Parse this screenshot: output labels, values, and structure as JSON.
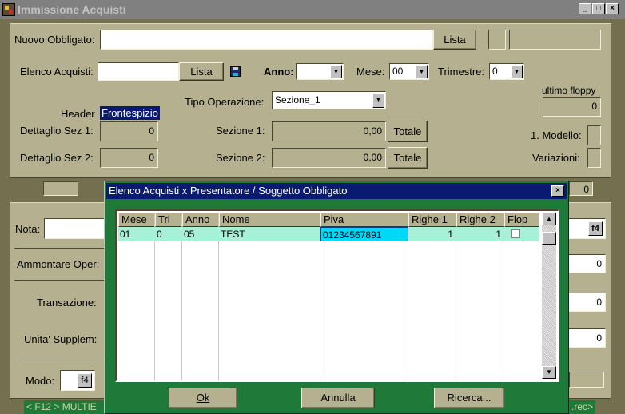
{
  "window": {
    "title": "Immissione  Acquisti"
  },
  "top": {
    "nuovo_obbligato_label": "Nuovo Obbligato:",
    "nuovo_obbligato_value": "",
    "lista1": "Lista",
    "elenco_acquisti_label": "Elenco Acquisti:",
    "lista2": "Lista",
    "anno_label": "Anno:",
    "anno_value": "",
    "mese_label": "Mese:",
    "mese_value": "00",
    "trimestre_label": "Trimestre:",
    "trimestre_value": "0",
    "ultimo_floppy_label": "ultimo floppy",
    "ultimo_floppy_value": "0",
    "tipo_operazione_label": "Tipo Operazione:",
    "tipo_operazione_value": "Sezione_1",
    "header_label": "Header",
    "header_value": "Frontespizio",
    "dettaglio_sez1_label": "Dettaglio Sez 1:",
    "dettaglio_sez1_value": "0",
    "sezione1_label": "Sezione 1:",
    "sezione1_value": "0,00",
    "totale1": "Totale",
    "modello_label": "1. Modello:",
    "dettaglio_sez2_label": "Dettaglio Sez 2:",
    "dettaglio_sez2_value": "0",
    "sezione2_label": "Sezione 2:",
    "sezione2_value": "0,00",
    "totale2": "Totale",
    "variazioni_label": "Variazioni:",
    "strip_value": "0"
  },
  "lower": {
    "nota_label": "Nota:",
    "nota_key": "f4",
    "ammontare_label": "Ammontare Oper:",
    "ammontare_value": "0",
    "transazione_label": "Transazione:",
    "transazione_value": "0",
    "unita_label": "Unita' Supplem:",
    "unita_value": "0",
    "modo_label": "Modo:",
    "modo_key": "f4"
  },
  "status": {
    "left": "< F12 > MULTIE",
    "right": ".rec>"
  },
  "dialog": {
    "title": "Elenco Acquisti x Presentatore / Soggetto Obbligato",
    "columns": [
      "Mese",
      "Tri",
      "Anno",
      "Nome",
      "Piva",
      "Righe 1",
      "Righe 2",
      "Flop"
    ],
    "rows": [
      {
        "mese": "01",
        "tri": "0",
        "anno": "05",
        "nome": "TEST",
        "piva": "01234567891",
        "righe1": "1",
        "righe2": "1"
      }
    ],
    "ok": "Ok",
    "annulla": "Annulla",
    "ricerca": "Ricerca..."
  }
}
